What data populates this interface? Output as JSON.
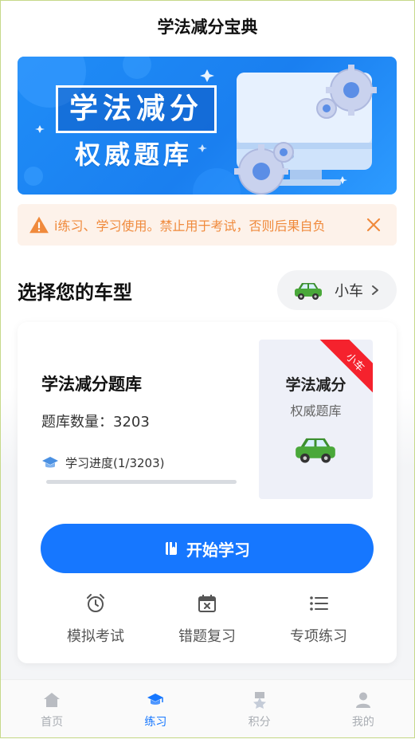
{
  "header": {
    "title": "学法减分宝典"
  },
  "banner": {
    "title": "学法减分",
    "subtitle": "权威题库",
    "colors": {
      "background": "#1a7ff0",
      "accent": "#ffffff"
    }
  },
  "notice": {
    "icon": "warning-icon",
    "text": "i练习、学习使用。禁止用于考试，否则后果自负",
    "close_icon": "close-icon",
    "color": "#f08a3c"
  },
  "vehicle_section": {
    "title": "选择您的车型",
    "selector": {
      "label": "小车",
      "icon": "car-icon"
    }
  },
  "card": {
    "title": "学法减分题库",
    "count_text": "题库数量：3203",
    "progress": {
      "label": "学习进度(1/3203)",
      "current": 1,
      "total": 3203,
      "fraction": 0.0003
    },
    "cover": {
      "title": "学法减分",
      "subtitle": "权威题库",
      "ribbon": "小车"
    },
    "start_button": {
      "label": "开始学习",
      "icon": "book-icon"
    },
    "actions": [
      {
        "label": "模拟考试",
        "icon": "alarm-clock-icon"
      },
      {
        "label": "错题复习",
        "icon": "calendar-x-icon"
      },
      {
        "label": "专项练习",
        "icon": "list-icon"
      }
    ]
  },
  "bottom_nav": {
    "items": [
      {
        "label": "首页",
        "icon": "home-icon",
        "active": false
      },
      {
        "label": "练习",
        "icon": "graduation-cap-icon",
        "active": true
      },
      {
        "label": "积分",
        "icon": "badge-icon",
        "active": false
      },
      {
        "label": "我的",
        "icon": "user-icon",
        "active": false
      }
    ],
    "active_color": "#1677ff",
    "inactive_color": "#a9adb3"
  }
}
